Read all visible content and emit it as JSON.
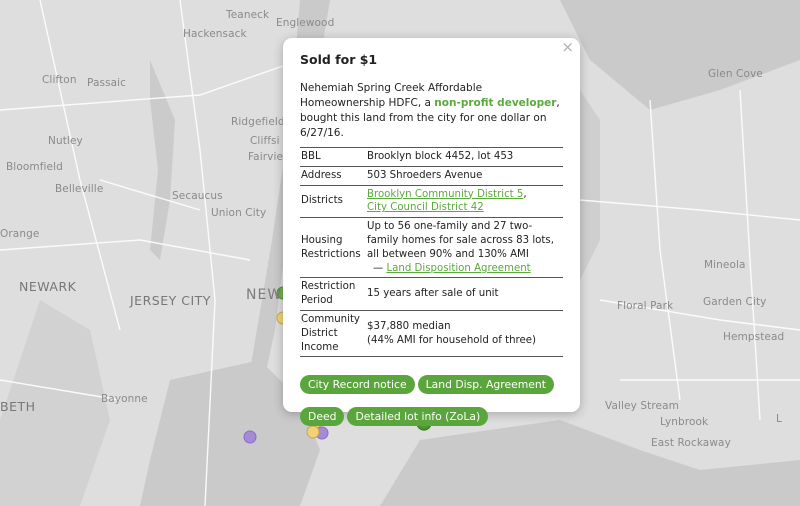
{
  "map": {
    "labels": {
      "teaneck": "Teaneck",
      "englewood": "Englewood",
      "hackensack": "Hackensack",
      "clifton": "Clifton",
      "passaic": "Passaic",
      "nutley": "Nutley",
      "ridgefield": "Ridgefield",
      "cliffside": "Cliffsi",
      "fairview": "Fairvie",
      "bloomfield": "Bloomfield",
      "belleville": "Belleville",
      "secaucus": "Secaucus",
      "union_city": "Union City",
      "orange": "Orange",
      "newark": "NEWARK",
      "jersey_city": "JERSEY CITY",
      "new_york": "NEW",
      "bayonne": "Bayonne",
      "elizabeth": "BETH",
      "glen_cove": "Glen Cove",
      "mineola": "Mineola",
      "floral_park": "Floral Park",
      "garden_city": "Garden City",
      "hempstead": "Hempstead",
      "valley_stream": "Valley Stream",
      "lynbrook": "Lynbrook",
      "east_rockaway": "East Rockaway",
      "lb": "L"
    }
  },
  "popup": {
    "close_glyph": "×",
    "title": "Sold for $1",
    "intro_before": "Nehemiah Spring Creek Affordable Homeownership HDFC, a ",
    "intro_link": "non-profit developer",
    "intro_after": ", bought this land from the city for one dollar on 6/27/16.",
    "rows": {
      "bbl": {
        "key": "BBL",
        "value": "Brooklyn block 4452, lot 453"
      },
      "address": {
        "key": "Address",
        "value": "503 Shroeders Avenue"
      },
      "districts": {
        "key": "Districts",
        "link1": "Brooklyn Community District 5",
        "sep": ",",
        "link2": "City Council District 42"
      },
      "housing": {
        "key": "Housing Restrictions",
        "value": "Up to 56 one-family and 27 two-family homes for sale across 83 lots, all between 90% and 130% AMI",
        "dash": "— ",
        "link": "Land Disposition Agreement"
      },
      "period": {
        "key": "Restriction Period",
        "value": "15 years after sale of unit"
      },
      "income": {
        "key": "Community District Income",
        "value1": "$37,880 median",
        "value2": "(44% AMI for household of three)"
      }
    },
    "buttons": {
      "city_record": "City Record notice",
      "land_disp": "Land Disp. Agreement",
      "deed": "Deed",
      "zola": "Detailed lot info (ZoLa)"
    }
  },
  "colors": {
    "accent_green": "#5aa63c",
    "marker_purple": "#9a7fd1",
    "marker_yellow": "#e8c25a",
    "water": "#c8c8c8",
    "land": "#dcdcdc"
  }
}
